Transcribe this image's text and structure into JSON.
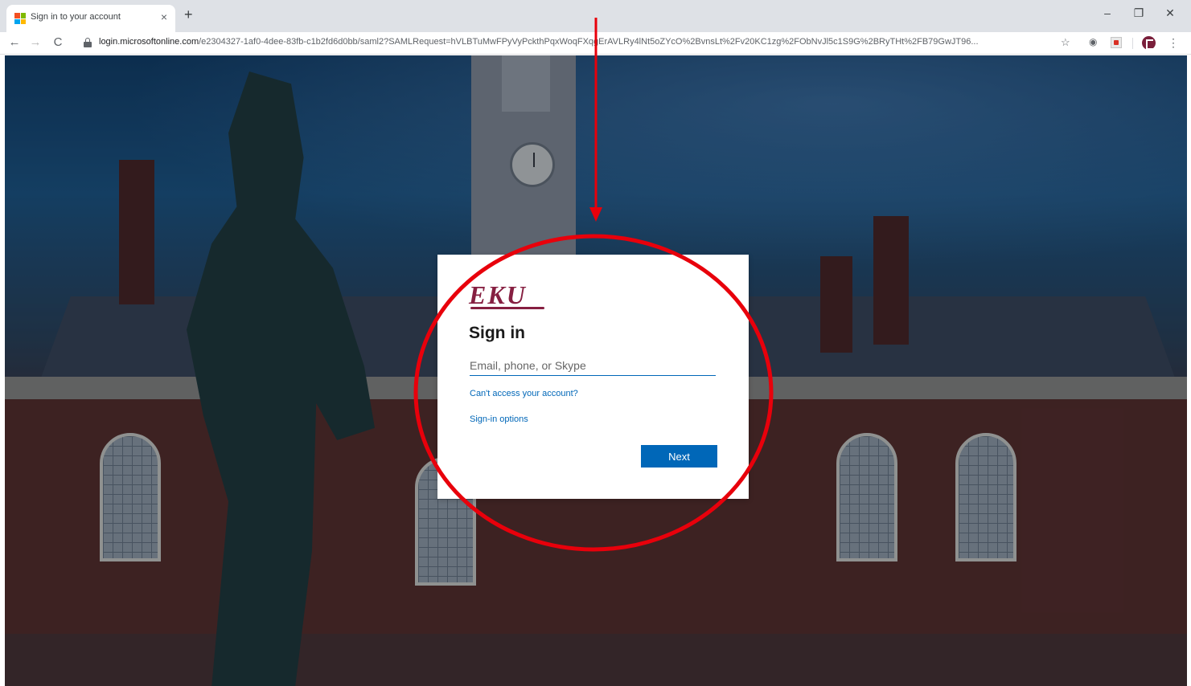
{
  "browser": {
    "tab_title": "Sign in to your account",
    "tab_close": "×",
    "new_tab": "+",
    "window_controls": {
      "minimize": "–",
      "restore": "❐",
      "close": "✕"
    },
    "nav": {
      "back": "←",
      "forward": "→",
      "reload": "C"
    },
    "url_host": "login.microsoftonline.com",
    "url_path": "/e2304327-1af0-4dee-83fb-c1b2fd6d0bb/saml2?SAMLRequest=hVLBTuMwFPyVyPckthPqxWoqFXqgErAVLRy4lNt5oZYcO%2BvnsLt%2Fv20KC1zg%2FObNvJl5c1S9G%2BRyTHt%2FB79GwJT96...",
    "star": "☆",
    "favicon_colors": [
      "#f25022",
      "#7fba00",
      "#00a4ef",
      "#ffb900"
    ]
  },
  "signin": {
    "logo": "EKU",
    "title": "Sign in",
    "email_placeholder": "Email, phone, or Skype",
    "cant_access": "Can't access your account?",
    "signin_options": "Sign-in options",
    "next": "Next",
    "brand_color": "#861f41",
    "accent_color": "#0067b8"
  },
  "annotation": {
    "color": "#e8000b",
    "shapes": [
      "arrow",
      "circle"
    ]
  }
}
